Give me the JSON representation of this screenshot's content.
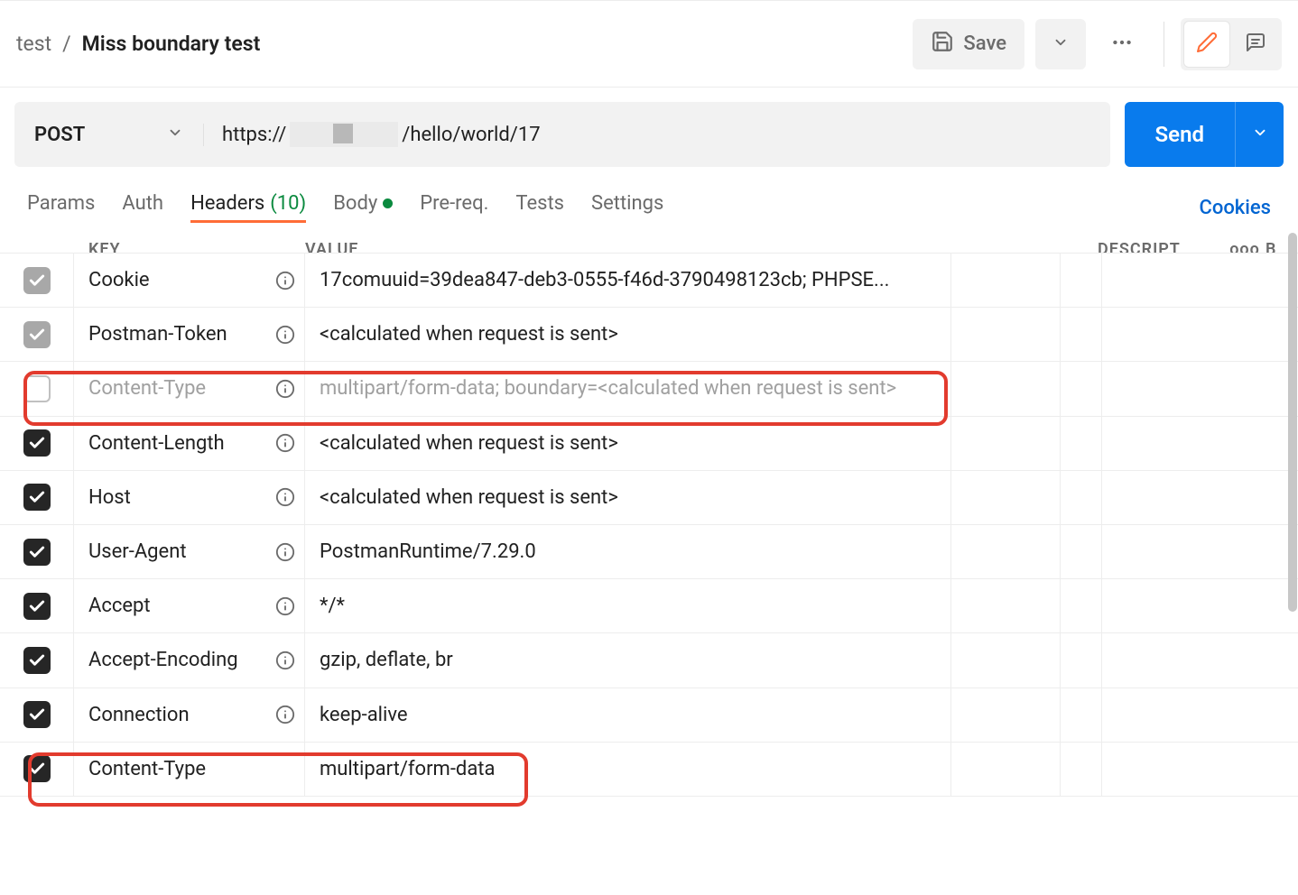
{
  "breadcrumb": {
    "folder": "test",
    "title": "Miss boundary test"
  },
  "toolbar": {
    "save": "Save"
  },
  "request": {
    "method": "POST",
    "url_prefix": "https://",
    "url_suffix": "/hello/world/17",
    "send": "Send"
  },
  "tabs": {
    "params": "Params",
    "auth": "Auth",
    "headers": "Headers",
    "headers_count": "(10)",
    "body": "Body",
    "prereq": "Pre-req.",
    "tests": "Tests",
    "settings": "Settings",
    "cookies": "Cookies"
  },
  "table_head": {
    "key": "KEY",
    "value": "VALUE",
    "desc": "DESCRIPT",
    "more": "ooo",
    "b": "B"
  },
  "headers": [
    {
      "enabled": "gray",
      "key": "Cookie",
      "info": true,
      "value": "17comuuid=39dea847-deb3-0555-f46d-3790498123cb; PHPSE..."
    },
    {
      "enabled": "gray",
      "key": "Postman-Token",
      "info": true,
      "value": "<calculated when request is sent>"
    },
    {
      "enabled": "empty",
      "key": "Content-Type",
      "info": true,
      "value": "multipart/form-data; boundary=<calculated when request is sent>",
      "disabled": true
    },
    {
      "enabled": "black",
      "key": "Content-Length",
      "info": true,
      "value": "<calculated when request is sent>"
    },
    {
      "enabled": "black",
      "key": "Host",
      "info": true,
      "value": "<calculated when request is sent>"
    },
    {
      "enabled": "black",
      "key": "User-Agent",
      "info": true,
      "value": "PostmanRuntime/7.29.0"
    },
    {
      "enabled": "black",
      "key": "Accept",
      "info": true,
      "value": "*/*"
    },
    {
      "enabled": "black",
      "key": "Accept-Encoding",
      "info": true,
      "value": "gzip, deflate, br"
    },
    {
      "enabled": "black",
      "key": "Connection",
      "info": true,
      "value": "keep-alive"
    },
    {
      "enabled": "black",
      "key": "Content-Type",
      "info": false,
      "value": "multipart/form-data"
    }
  ]
}
